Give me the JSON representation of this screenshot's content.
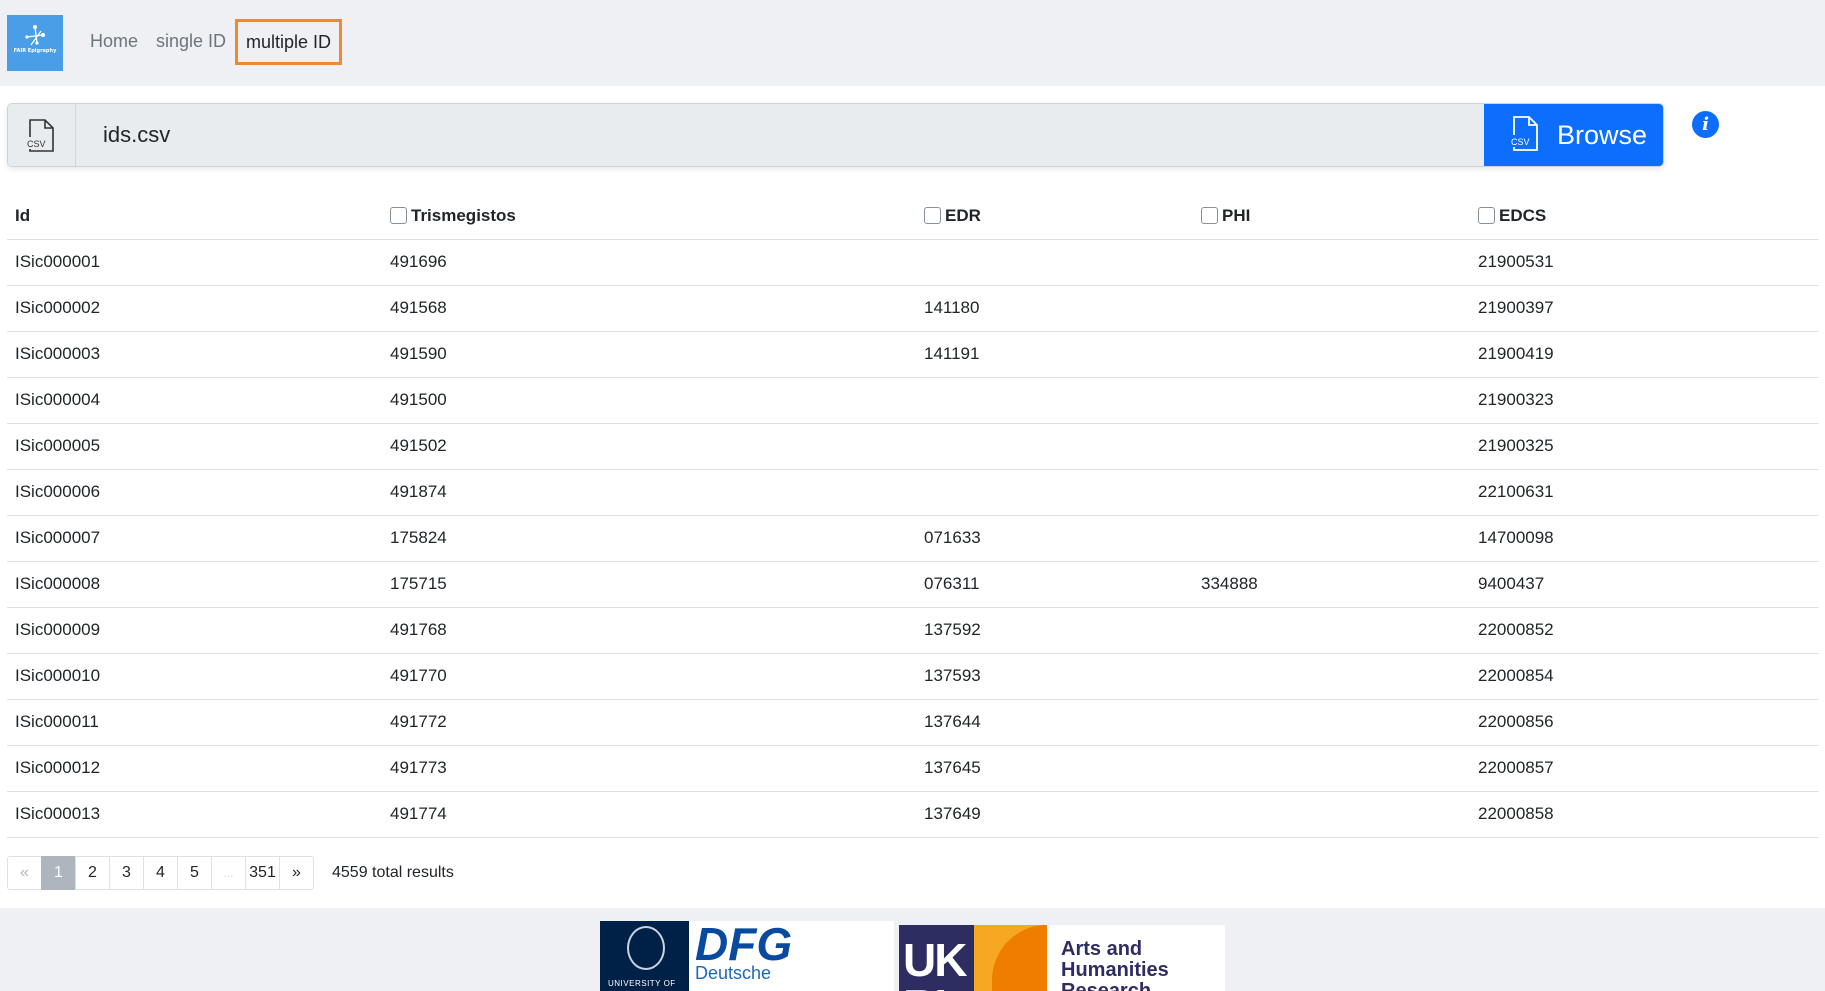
{
  "nav": {
    "logo_text": "FAIR Epigraphy",
    "links": [
      "Home",
      "single ID",
      "multiple ID"
    ]
  },
  "file_input": {
    "prefix_icon": "csv-file-icon",
    "file_name": "ids.csv",
    "browse_label": "Browse",
    "browse_icon": "csv-file-icon",
    "icon_label": "CSV"
  },
  "info_icon_glyph": "i",
  "table": {
    "headers": [
      "Id",
      "Trismegistos",
      "EDR",
      "PHI",
      "EDCS"
    ],
    "rows": [
      [
        "ISic000001",
        "491696",
        "",
        "",
        "21900531"
      ],
      [
        "ISic000002",
        "491568",
        "141180",
        "",
        "21900397"
      ],
      [
        "ISic000003",
        "491590",
        "141191",
        "",
        "21900419"
      ],
      [
        "ISic000004",
        "491500",
        "",
        "",
        "21900323"
      ],
      [
        "ISic000005",
        "491502",
        "",
        "",
        "21900325"
      ],
      [
        "ISic000006",
        "491874",
        "",
        "",
        "22100631"
      ],
      [
        "ISic000007",
        "175824",
        "071633",
        "",
        "14700098"
      ],
      [
        "ISic000008",
        "175715",
        "076311",
        "334888",
        "9400437"
      ],
      [
        "ISic000009",
        "491768",
        "137592",
        "",
        "22000852"
      ],
      [
        "ISic000010",
        "491770",
        "137593",
        "",
        "22000854"
      ],
      [
        "ISic000011",
        "491772",
        "137644",
        "",
        "22000856"
      ],
      [
        "ISic000012",
        "491773",
        "137645",
        "",
        "22000857"
      ],
      [
        "ISic000013",
        "491774",
        "137649",
        "",
        "22000858"
      ]
    ]
  },
  "pagination": {
    "prev": "«",
    "pages": [
      "1",
      "2",
      "3",
      "4",
      "5",
      "...",
      "351"
    ],
    "next": "»",
    "active_page": "1",
    "total_text": "4559 total results"
  },
  "footer": {
    "oxford_text": "UNIVERSITY OF",
    "dfg_mark": "DFG",
    "dfg_text": "Deutsche",
    "ukri_mark": "UK RI",
    "ahrc_line1": "Arts and",
    "ahrc_line2": "Humanities",
    "ahrc_line3": "Research Council"
  },
  "colors": {
    "accent": "#0d6efd",
    "active_nav_border": "#f0892e",
    "navbar_bg": "#eef0f3",
    "logo_bg": "#4a9ee8"
  }
}
